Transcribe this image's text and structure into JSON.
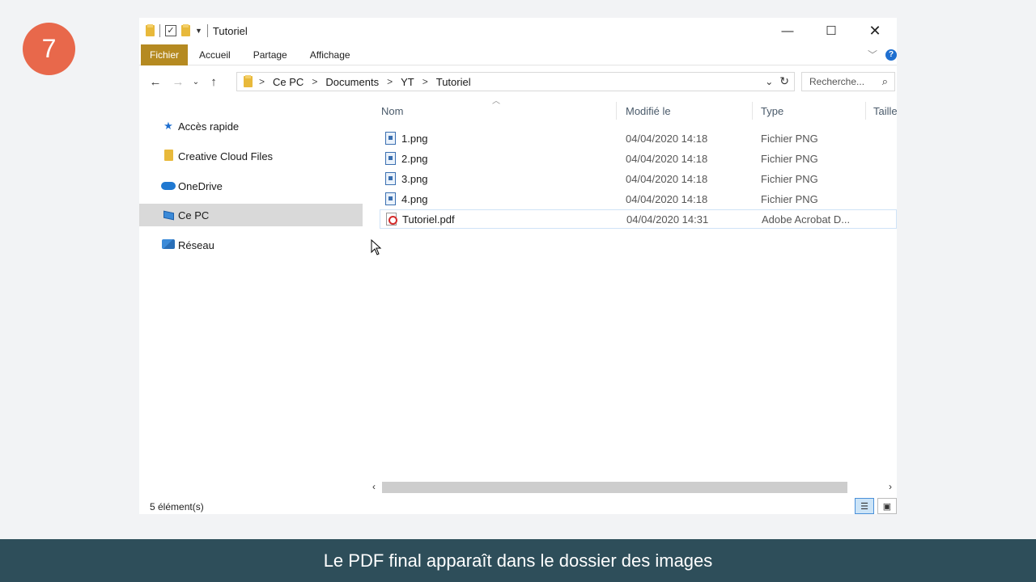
{
  "step_number": "7",
  "window": {
    "title": "Tutoriel",
    "controls": {
      "minimize": "—",
      "maximize": "☐",
      "close": "✕"
    }
  },
  "ribbon": {
    "tabs": [
      "Fichier",
      "Accueil",
      "Partage",
      "Affichage"
    ]
  },
  "address_bar": {
    "breadcrumbs": [
      "Ce PC",
      "Documents",
      "YT",
      "Tutoriel"
    ],
    "search_placeholder": "Recherche..."
  },
  "sidebar": {
    "items": [
      {
        "label": "Accès rapide",
        "icon": "star-icon"
      },
      {
        "label": "Creative Cloud Files",
        "icon": "folder-icon"
      },
      {
        "label": "OneDrive",
        "icon": "cloud-icon"
      },
      {
        "label": "Ce PC",
        "icon": "computer-icon",
        "selected": true
      },
      {
        "label": "Réseau",
        "icon": "network-icon"
      }
    ]
  },
  "file_list": {
    "columns": [
      "Nom",
      "Modifié le",
      "Type",
      "Taille"
    ],
    "rows": [
      {
        "name": "1.png",
        "modified": "04/04/2020 14:18",
        "type": "Fichier PNG",
        "icon": "image-file-icon"
      },
      {
        "name": "2.png",
        "modified": "04/04/2020 14:18",
        "type": "Fichier PNG",
        "icon": "image-file-icon"
      },
      {
        "name": "3.png",
        "modified": "04/04/2020 14:18",
        "type": "Fichier PNG",
        "icon": "image-file-icon"
      },
      {
        "name": "4.png",
        "modified": "04/04/2020 14:18",
        "type": "Fichier PNG",
        "icon": "image-file-icon"
      },
      {
        "name": "Tutoriel.pdf",
        "modified": "04/04/2020 14:31",
        "type": "Adobe Acrobat D...",
        "icon": "pdf-file-icon"
      }
    ]
  },
  "status_bar": {
    "item_count": "5 élément(s)"
  },
  "caption": "Le PDF final apparaît dans le dossier des images",
  "colors": {
    "badge": "#e8684b",
    "file_tab": "#b58a21",
    "caption_bg": "#2e4e5a",
    "selection": "#d9d9d9"
  }
}
